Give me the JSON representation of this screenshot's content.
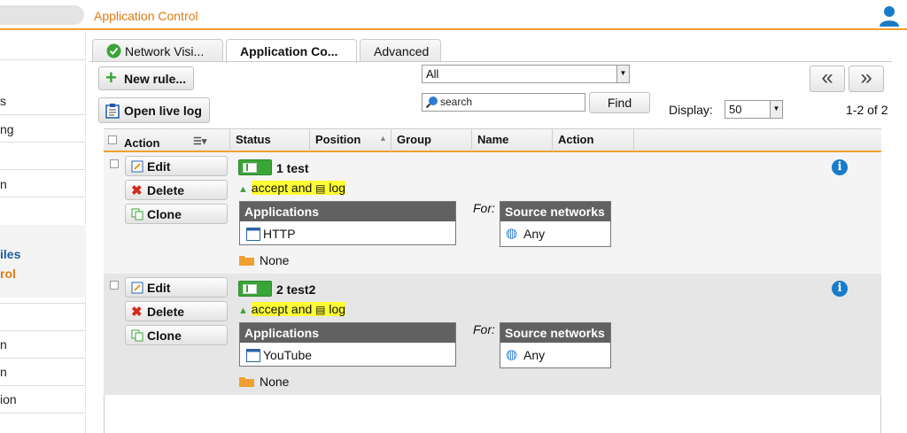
{
  "header": {
    "title": "Application Control"
  },
  "sidebar": {
    "items": [
      "s",
      "ng",
      "n",
      "iles",
      "rol",
      "n",
      "n",
      "ion"
    ]
  },
  "tabs": [
    {
      "label": "Network Visi..."
    },
    {
      "label": "Application Co..."
    },
    {
      "label": "Advanced"
    }
  ],
  "toolbar": {
    "new_rule": "New rule...",
    "open_live_log": "Open live log",
    "filter_select": "All",
    "search_placeholder": "search",
    "find": "Find",
    "display_label": "Display:",
    "display_value": "50",
    "pagination": "1-2 of 2",
    "prev": "«",
    "next": "»"
  },
  "table": {
    "columns": [
      "Action",
      "Status",
      "Position",
      "Group",
      "Name",
      "Action"
    ]
  },
  "rules": [
    {
      "edit": "Edit",
      "delete": "Delete",
      "clone": "Clone",
      "name": "1 test",
      "accept": "accept and",
      "log": "log",
      "apps_header": "Applications",
      "app": "HTTP",
      "for": "For:",
      "src_header": "Source networks",
      "src": "Any",
      "none": "None",
      "info": "i"
    },
    {
      "edit": "Edit",
      "delete": "Delete",
      "clone": "Clone",
      "name": "2 test2",
      "accept": "accept and",
      "log": "log",
      "apps_header": "Applications",
      "app": "YouTube",
      "for": "For:",
      "src_header": "Source networks",
      "src": "Any",
      "none": "None",
      "info": "i"
    }
  ],
  "colors": {
    "accent": "#f0a030",
    "title": "#e07a10",
    "enabled": "#3aa537",
    "highlight": "#ffff33",
    "info": "#1a7bc8"
  }
}
